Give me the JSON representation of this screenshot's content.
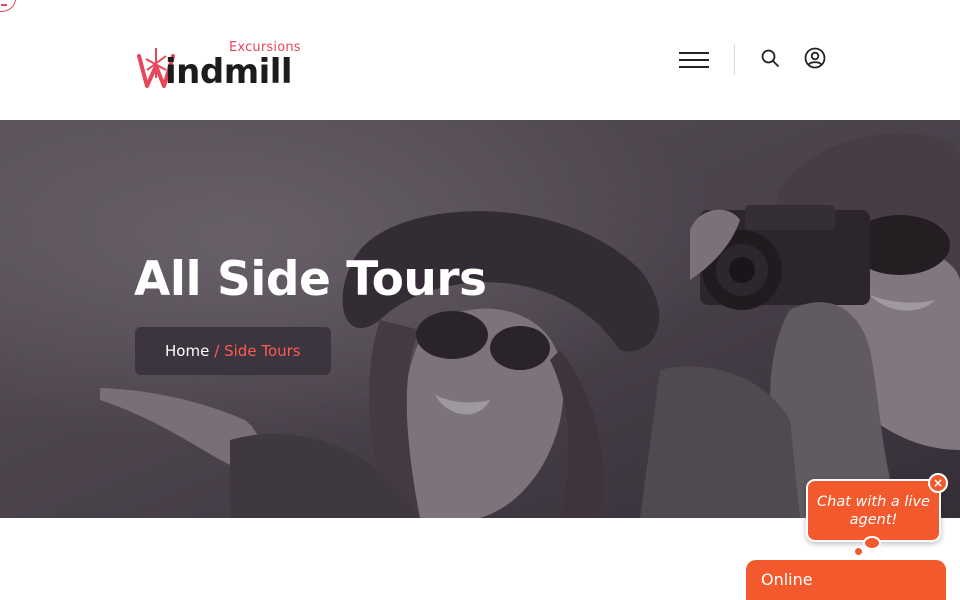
{
  "header": {
    "logo": {
      "sub_text": "Excursions",
      "main_text": "indmill"
    },
    "menu_icon": "hamburger-icon",
    "search_icon": "search-icon",
    "account_icon": "user-circle-icon"
  },
  "hero": {
    "title": "All Side Tours",
    "breadcrumb": {
      "home": "Home",
      "current": "/ Side Tours"
    }
  },
  "chat": {
    "bubble_text": "Chat with a live agent!",
    "close_label": "×",
    "status": "Online"
  },
  "colors": {
    "accent": "#e8465a",
    "chat": "#f25a2e",
    "breadcrumb_active": "#ff5a4f"
  }
}
